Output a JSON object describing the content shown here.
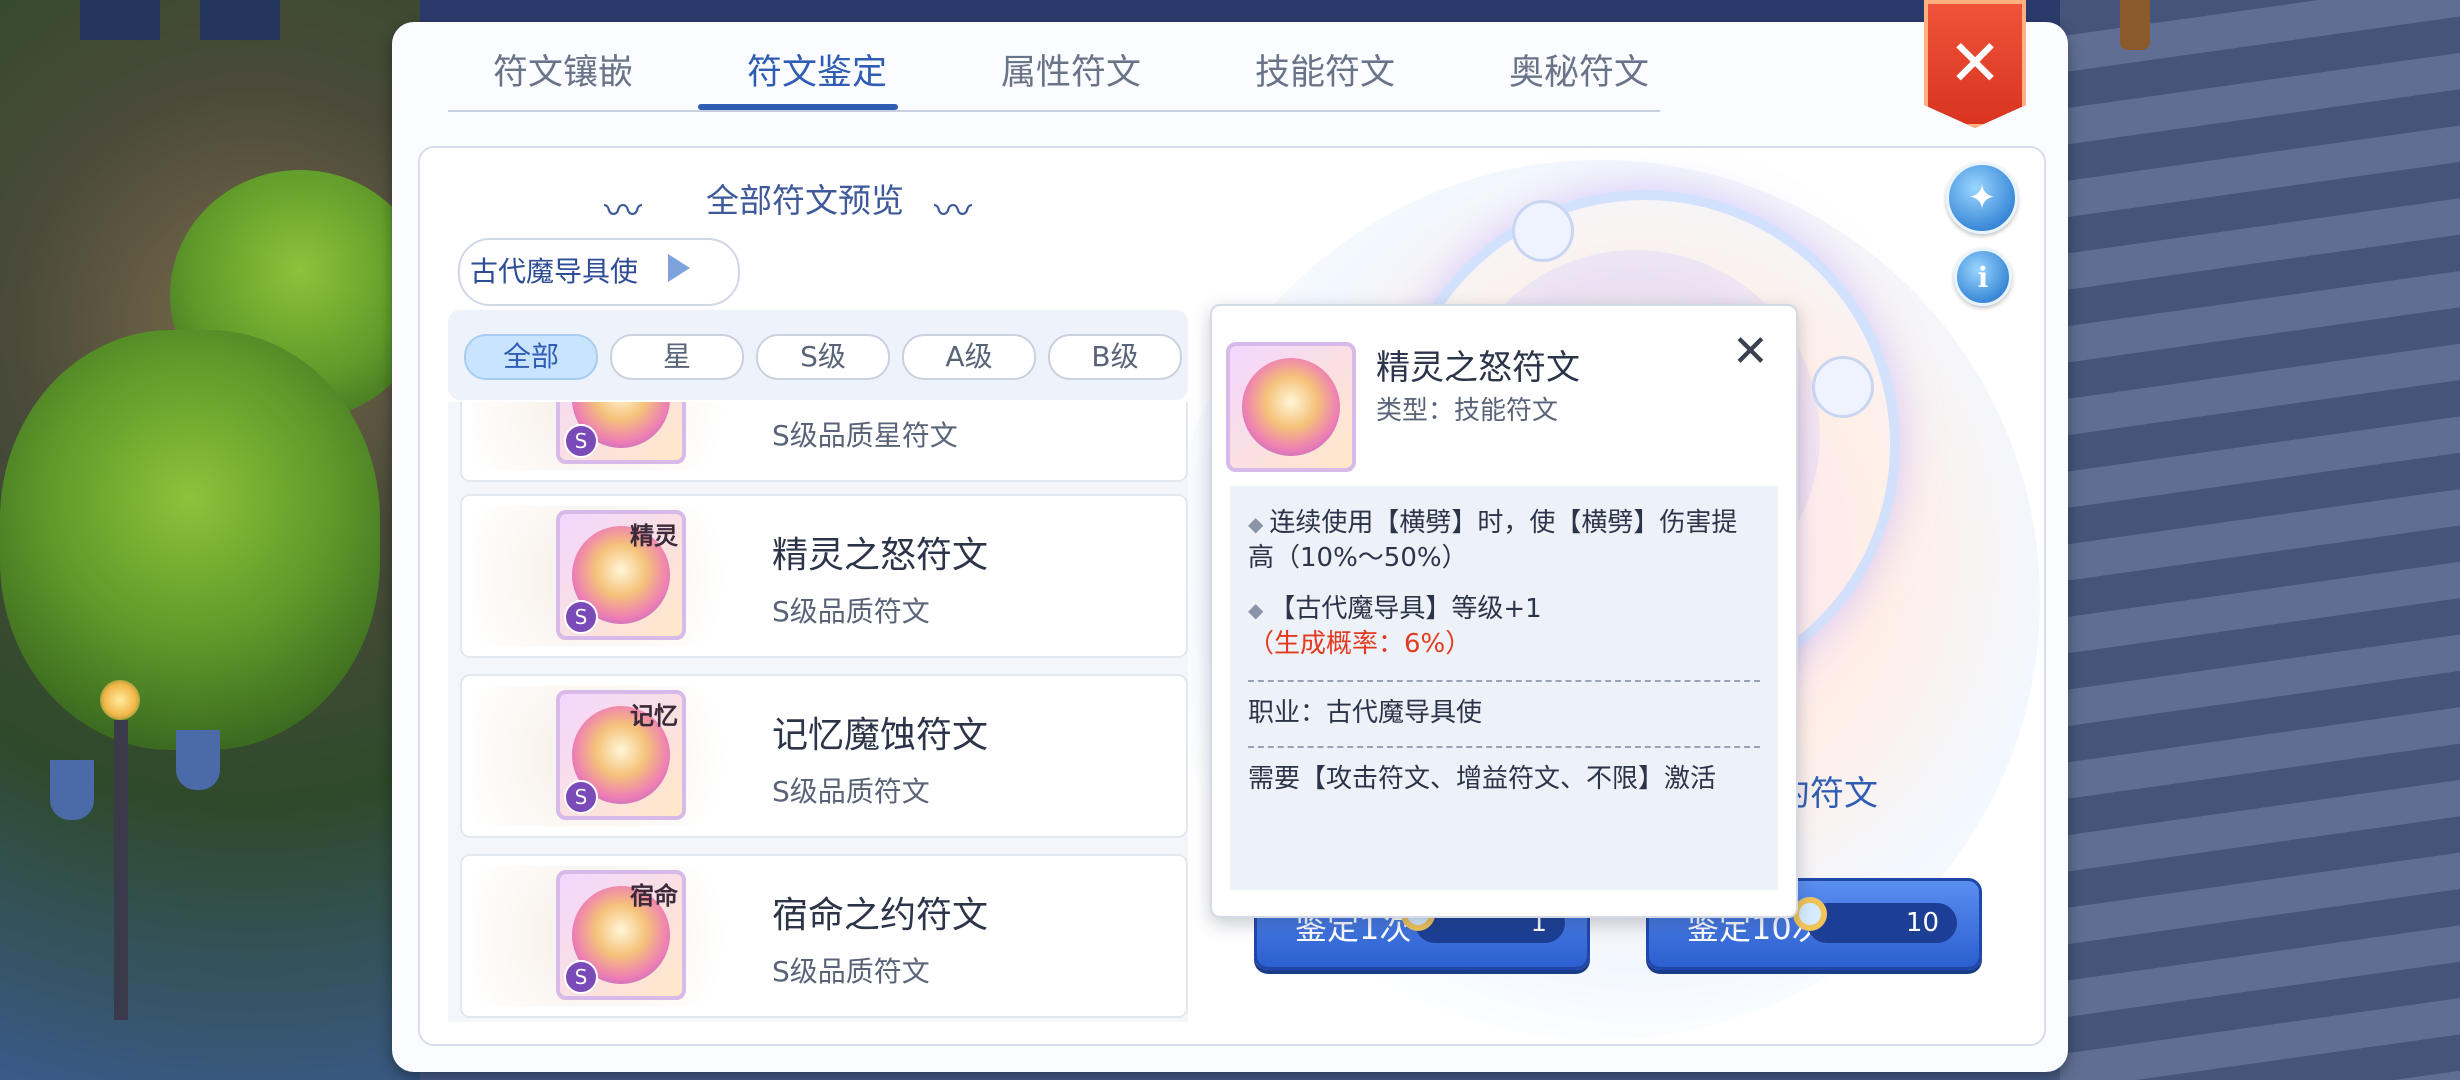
{
  "tabs": [
    "符文镶嵌",
    "符文鉴定",
    "属性符文",
    "技能符文",
    "奥秘符文"
  ],
  "active_tab": "符文鉴定",
  "close_icon": "✕",
  "preview_title": "全部符文预览",
  "swirl_glyph": "〰",
  "class_selector": "古代魔导具使",
  "filters": [
    "全部",
    "星",
    "S级",
    "A级",
    "B级"
  ],
  "active_filter": "全部",
  "rune_list": [
    {
      "name": "",
      "grade": "S级品质星符文",
      "tag": "",
      "badge": "S"
    },
    {
      "name": "精灵之怒符文",
      "grade": "S级品质符文",
      "tag": "精灵",
      "badge": "S"
    },
    {
      "name": "记忆魔蚀符文",
      "grade": "S级品质符文",
      "tag": "记忆",
      "badge": "S"
    },
    {
      "name": "宿命之约符文",
      "grade": "S级品质符文",
      "tag": "宿命",
      "badge": "S"
    }
  ],
  "actions": [
    {
      "label": "鉴定1次",
      "count": "1"
    },
    {
      "label": "鉴定10次",
      "count": "10"
    }
  ],
  "side_label": "约符文",
  "popup": {
    "title": "精灵之怒符文",
    "type": "类型：技能符文",
    "effect1": "连续使用【横劈】时，使【横劈】伤害提高（10%～50%）",
    "effect2_main": "【古代魔导具】等级+1",
    "effect2_chance": "（生成概率：6%）",
    "class_req": "职业：古代魔导具使",
    "activation": "需要【攻击符文、增益符文、不限】激活"
  },
  "colors": {
    "accent": "#2f5db4",
    "close_red": "#e0402a",
    "highlight_red": "#e33a1f"
  }
}
